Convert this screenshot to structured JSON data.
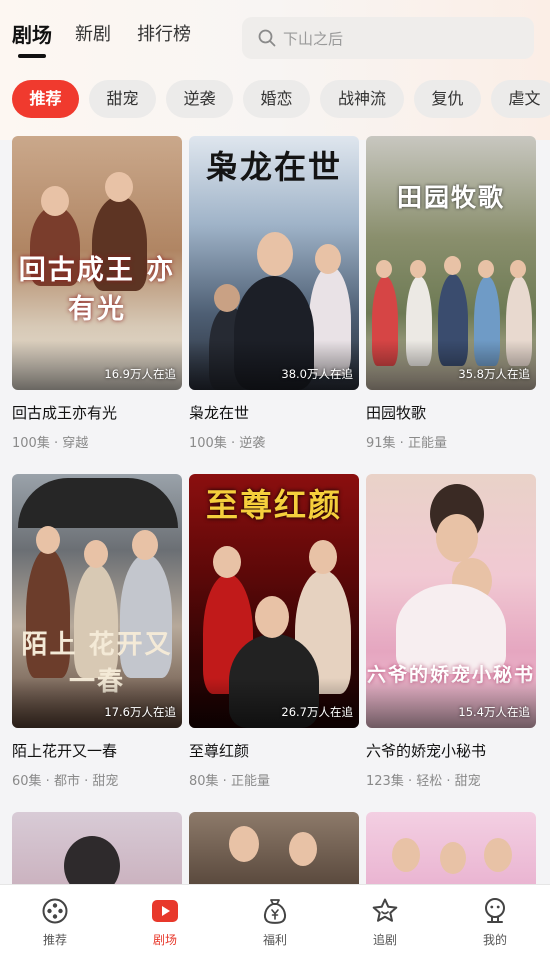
{
  "header": {
    "tabs": [
      {
        "label": "剧场",
        "active": true
      },
      {
        "label": "新剧",
        "active": false
      },
      {
        "label": "排行榜",
        "active": false
      }
    ],
    "search": {
      "placeholder": "下山之后"
    }
  },
  "chips": [
    {
      "label": "推荐",
      "active": true
    },
    {
      "label": "甜宠"
    },
    {
      "label": "逆袭"
    },
    {
      "label": "婚恋"
    },
    {
      "label": "战神流"
    },
    {
      "label": "复仇"
    },
    {
      "label": "虐文"
    }
  ],
  "dramas": [
    {
      "title": "回古成王亦有光",
      "poster_text": "回古成王 亦有光",
      "followers": "16.9万人在追",
      "meta": "100集 · 穿越"
    },
    {
      "title": "枭龙在世",
      "poster_text": "枭龙在世",
      "followers": "38.0万人在追",
      "meta": "100集 · 逆袭"
    },
    {
      "title": "田园牧歌",
      "poster_text": "田园牧歌",
      "followers": "35.8万人在追",
      "meta": "91集 · 正能量"
    },
    {
      "title": "陌上花开又一春",
      "poster_text": "陌上 花开又一春",
      "followers": "17.6万人在追",
      "meta": "60集 · 都市 · 甜宠"
    },
    {
      "title": "至尊红颜",
      "poster_text": "至尊红颜",
      "followers": "26.7万人在追",
      "meta": "80集 · 正能量"
    },
    {
      "title": "六爷的娇宠小秘书",
      "poster_text": "六爷的娇宠小秘书",
      "followers": "15.4万人在追",
      "meta": "123集 · 轻松 · 甜宠"
    }
  ],
  "bottom_nav": [
    {
      "label": "推荐",
      "icon": "film-reel-icon",
      "active": false
    },
    {
      "label": "剧场",
      "icon": "play-icon",
      "active": true
    },
    {
      "label": "福利",
      "icon": "money-bag-icon",
      "active": false
    },
    {
      "label": "追剧",
      "icon": "star-icon",
      "active": false
    },
    {
      "label": "我的",
      "icon": "profile-icon",
      "active": false
    }
  ],
  "colors": {
    "accent": "#f03a2e",
    "active_nav": "#e8382b"
  }
}
